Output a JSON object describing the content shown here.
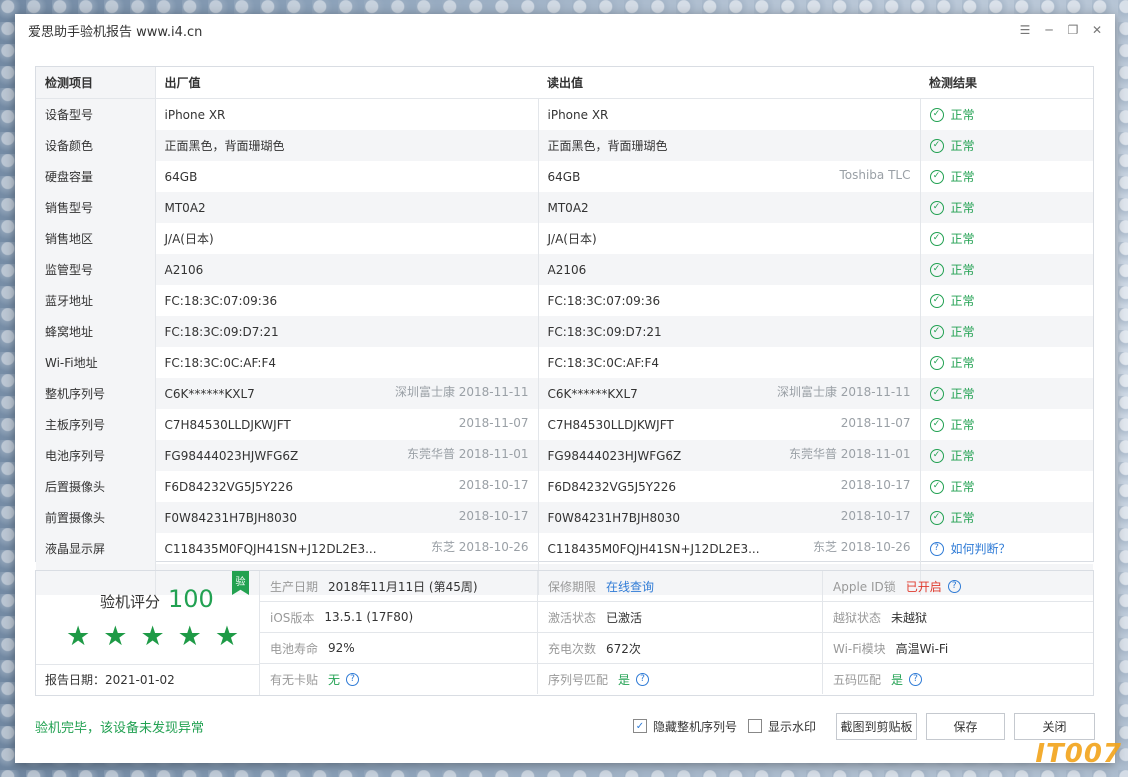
{
  "window": {
    "title": "爱思助手验机报告 www.i4.cn"
  },
  "table": {
    "headers": [
      "检测项目",
      "出厂值",
      "读出值",
      "检测结果"
    ],
    "rows": [
      {
        "item": "设备型号",
        "factory": "iPhone XR",
        "factory_meta": "",
        "read": "iPhone XR",
        "read_meta": "",
        "result": "正常",
        "status": "ok"
      },
      {
        "item": "设备颜色",
        "factory": "正面黑色，背面珊瑚色",
        "factory_meta": "",
        "read": "正面黑色，背面珊瑚色",
        "read_meta": "",
        "result": "正常",
        "status": "ok"
      },
      {
        "item": "硬盘容量",
        "factory": "64GB",
        "factory_meta": "",
        "read": "64GB",
        "read_meta": "Toshiba TLC",
        "result": "正常",
        "status": "ok"
      },
      {
        "item": "销售型号",
        "factory": "MT0A2",
        "factory_meta": "",
        "read": "MT0A2",
        "read_meta": "",
        "result": "正常",
        "status": "ok"
      },
      {
        "item": "销售地区",
        "factory": "J/A(日本)",
        "factory_meta": "",
        "read": "J/A(日本)",
        "read_meta": "",
        "result": "正常",
        "status": "ok"
      },
      {
        "item": "监管型号",
        "factory": "A2106",
        "factory_meta": "",
        "read": "A2106",
        "read_meta": "",
        "result": "正常",
        "status": "ok"
      },
      {
        "item": "蓝牙地址",
        "factory": "FC:18:3C:07:09:36",
        "factory_meta": "",
        "read": "FC:18:3C:07:09:36",
        "read_meta": "",
        "result": "正常",
        "status": "ok"
      },
      {
        "item": "蜂窝地址",
        "factory": "FC:18:3C:09:D7:21",
        "factory_meta": "",
        "read": "FC:18:3C:09:D7:21",
        "read_meta": "",
        "result": "正常",
        "status": "ok"
      },
      {
        "item": "Wi-Fi地址",
        "factory": "FC:18:3C:0C:AF:F4",
        "factory_meta": "",
        "read": "FC:18:3C:0C:AF:F4",
        "read_meta": "",
        "result": "正常",
        "status": "ok"
      },
      {
        "item": "整机序列号",
        "factory": "C6K******KXL7",
        "factory_meta": "深圳富士康 2018-11-11",
        "read": "C6K******KXL7",
        "read_meta": "深圳富士康 2018-11-11",
        "result": "正常",
        "status": "ok"
      },
      {
        "item": "主板序列号",
        "factory": "C7H84530LLDJKWJFT",
        "factory_meta": "2018-11-07",
        "read": "C7H84530LLDJKWJFT",
        "read_meta": "2018-11-07",
        "result": "正常",
        "status": "ok"
      },
      {
        "item": "电池序列号",
        "factory": "FG98444023HJWFG6Z",
        "factory_meta": "东莞华普 2018-11-01",
        "read": "FG98444023HJWFG6Z",
        "read_meta": "东莞华普 2018-11-01",
        "result": "正常",
        "status": "ok"
      },
      {
        "item": "后置摄像头",
        "factory": "F6D84232VG5J5Y226",
        "factory_meta": "2018-10-17",
        "read": "F6D84232VG5J5Y226",
        "read_meta": "2018-10-17",
        "result": "正常",
        "status": "ok"
      },
      {
        "item": "前置摄像头",
        "factory": "F0W84231H7BJH8030",
        "factory_meta": "2018-10-17",
        "read": "F0W84231H7BJH8030",
        "read_meta": "2018-10-17",
        "result": "正常",
        "status": "ok"
      },
      {
        "item": "液晶显示屏",
        "factory": "C118435M0FQJH41SN+J12DL2E3...",
        "factory_meta": "东芝 2018-10-26",
        "read": "C118435M0FQJH41SN+J12DL2E3...",
        "read_meta": "东芝 2018-10-26",
        "result": "如何判断？",
        "status": "question"
      }
    ]
  },
  "score": {
    "label": "验机评分",
    "value": "100",
    "badge": "验",
    "stars": 5,
    "report_date": "报告日期：2021-01-02"
  },
  "info": [
    {
      "key": "生产日期",
      "value": "2018年11月11日 (第45周)",
      "style": "plain",
      "help": false
    },
    {
      "key": "保修期限",
      "value": "在线查询",
      "style": "link",
      "help": false
    },
    {
      "key": "Apple ID锁",
      "value": "已开启",
      "style": "red",
      "help": true
    },
    {
      "key": "iOS版本",
      "value": "13.5.1 (17F80)",
      "style": "plain",
      "help": false
    },
    {
      "key": "激活状态",
      "value": "已激活",
      "style": "plain",
      "help": false
    },
    {
      "key": "越狱状态",
      "value": "未越狱",
      "style": "plain",
      "help": false
    },
    {
      "key": "电池寿命",
      "value": "92%",
      "style": "plain",
      "help": false
    },
    {
      "key": "充电次数",
      "value": "672次",
      "style": "plain",
      "help": false
    },
    {
      "key": "Wi-Fi模块",
      "value": "高温Wi-Fi",
      "style": "plain",
      "help": false
    },
    {
      "key": "有无卡贴",
      "value": "无",
      "style": "green",
      "help": true
    },
    {
      "key": "序列号匹配",
      "value": "是",
      "style": "green",
      "help": true
    },
    {
      "key": "五码匹配",
      "value": "是",
      "style": "green",
      "help": true
    }
  ],
  "footer": {
    "status": "验机完毕，该设备未发现异常",
    "hide_serial_label": "隐藏整机序列号",
    "hide_serial_checked": true,
    "watermark_label": "显示水印",
    "watermark_checked": false,
    "copy_button": "截图到剪贴板",
    "save_button": "保存",
    "close_button": "关闭"
  },
  "corner_watermark": "IT007",
  "colors": {
    "ok": "#22a152",
    "link": "#2f7bd6",
    "warn": "#e03b2e"
  }
}
